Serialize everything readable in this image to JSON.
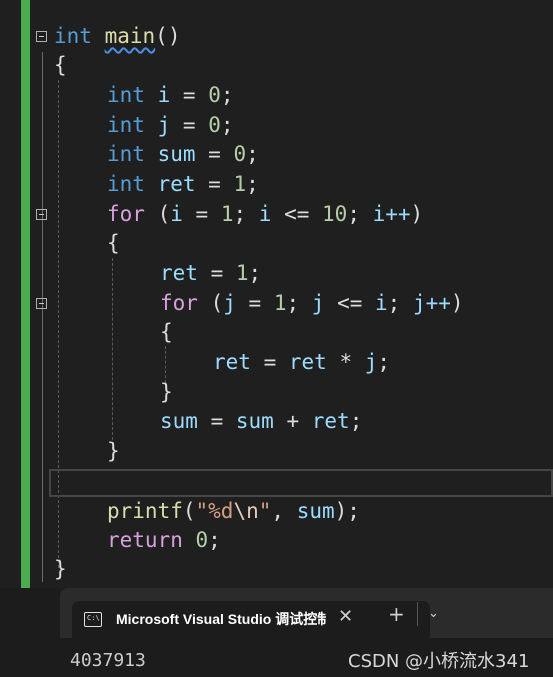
{
  "editor": {
    "tokens": {
      "int": "int",
      "main": "main",
      "main_paren": "()",
      "brace_open": "{",
      "brace_close": "}",
      "i": "i",
      "j": "j",
      "sum": "sum",
      "ret": "ret",
      "eq": " = ",
      "zero": "0",
      "one": "1",
      "ten": "10",
      "semi": ";",
      "for": "for",
      "for_open": " (",
      "le": " <= ",
      "semi_sp": "; ",
      "incr_i": "i++",
      "incr_j": "j++",
      "close_paren": ")",
      "times": " * ",
      "plus": " + ",
      "printf": "printf",
      "paren_open": "(",
      "str_quote_open": "\"%d",
      "str_esc": "\\n",
      "str_quote_close": "\"",
      "comma_sp": ", ",
      "close_semi": ");",
      "return": "return",
      "space": " "
    }
  },
  "terminal": {
    "tab_title": "Microsoft Visual Studio 调试控制台",
    "output": "4037913",
    "close_symbol": "✕",
    "new_tab_symbol": "+",
    "dropdown_symbol": "⌄"
  },
  "watermark": "CSDN @小桥流水341",
  "colors": {
    "background": "#1f1f1f",
    "keyword": "#569cd6",
    "control_keyword": "#d8a0df",
    "function": "#dcdcaa",
    "variable": "#9cdcfe",
    "number": "#b5cea8",
    "string": "#d69d85",
    "change_bar": "#4aae50"
  }
}
